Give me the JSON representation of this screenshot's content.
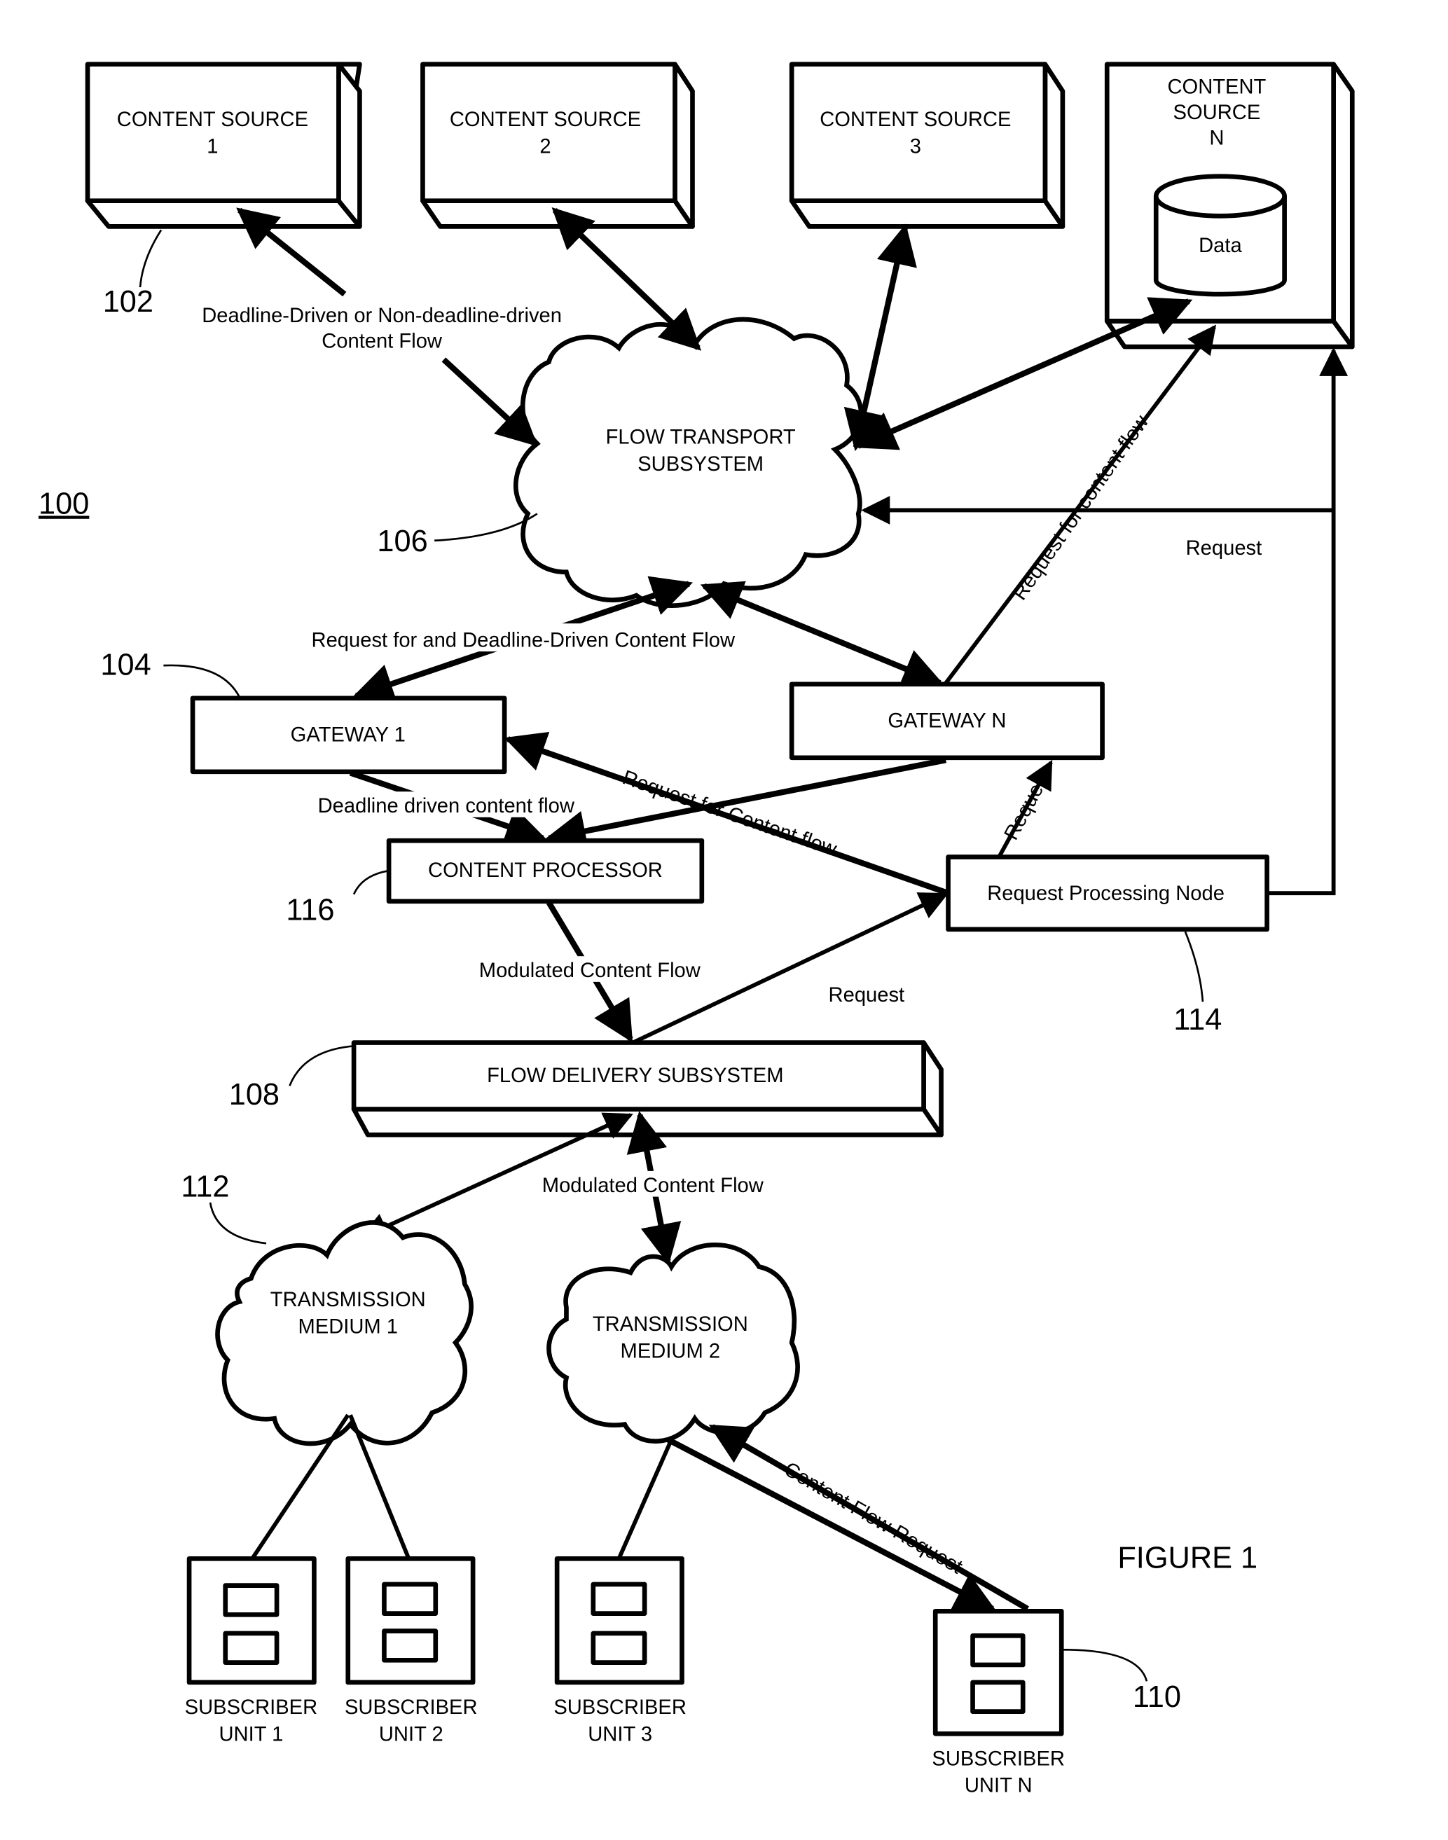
{
  "figure": {
    "title": "FIGURE 1",
    "system_ref": "100"
  },
  "content_sources": [
    {
      "line1": "CONTENT SOURCE",
      "line2": "1"
    },
    {
      "line1": "CONTENT SOURCE",
      "line2": "2"
    },
    {
      "line1": "CONTENT SOURCE",
      "line2": "3"
    },
    {
      "line1": "CONTENT",
      "line2": "SOURCE",
      "line3": "N",
      "database": "Data"
    }
  ],
  "flow_transport": {
    "line1": "FLOW TRANSPORT",
    "line2": "SUBSYSTEM",
    "ref": "106"
  },
  "gateways": [
    {
      "label": "GATEWAY 1",
      "ref": "104"
    },
    {
      "label": "GATEWAY N"
    }
  ],
  "content_processor": {
    "label": "CONTENT PROCESSOR",
    "ref": "116"
  },
  "request_processing_node": {
    "label": "Request Processing Node",
    "ref": "114"
  },
  "flow_delivery": {
    "label": "FLOW DELIVERY SUBSYSTEM",
    "ref": "108"
  },
  "transmission_media": [
    {
      "line1": "TRANSMISSION",
      "line2": "MEDIUM 1",
      "ref": "112"
    },
    {
      "line1": "TRANSMISSION",
      "line2": "MEDIUM 2"
    }
  ],
  "subscriber_units": [
    {
      "line1": "SUBSCRIBER",
      "line2": "UNIT 1"
    },
    {
      "line1": "SUBSCRIBER",
      "line2": "UNIT 2"
    },
    {
      "line1": "SUBSCRIBER",
      "line2": "UNIT 3"
    },
    {
      "line1": "SUBSCRIBER",
      "line2": "UNIT N",
      "ref": "110"
    }
  ],
  "refs": {
    "content_source": "102"
  },
  "edge_labels": {
    "source_flow_line1": "Deadline-Driven or Non-deadline-driven",
    "source_flow_line2": "Content Flow",
    "request_for_content_flow": "Request for content flow",
    "request_right": "Request",
    "gateway_flow": "Request for and Deadline-Driven Content Flow",
    "request_for_content_flow_2": "Request for Content flow",
    "deadline_driven": "Deadline driven content flow",
    "request_gateway_n": "Request",
    "modulated_1": "Modulated Content Flow",
    "request_delivery": "Request",
    "modulated_2": "Modulated Content Flow",
    "content_flow_request": "Content Flow Request"
  }
}
